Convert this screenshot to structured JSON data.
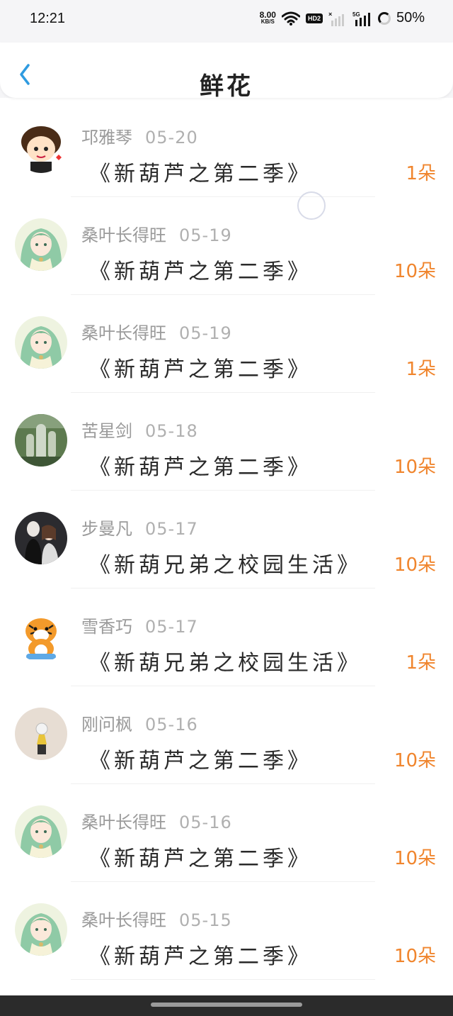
{
  "status_bar": {
    "time": "12:21",
    "net_speed_value": "8.00",
    "net_speed_unit": "KB/S",
    "hd_label": "HD2",
    "network_label": "5G",
    "battery": "50%"
  },
  "header": {
    "title": "鲜花"
  },
  "records": [
    {
      "name": "邛雅琴",
      "date": "05-20",
      "work": "《新葫芦之第二季》",
      "amount": "1朵",
      "avatar": "cartoon-boy"
    },
    {
      "name": "桑叶长得旺",
      "date": "05-19",
      "work": "《新葫芦之第二季》",
      "amount": "10朵",
      "avatar": "anime-girl"
    },
    {
      "name": "桑叶长得旺",
      "date": "05-19",
      "work": "《新葫芦之第二季》",
      "amount": "1朵",
      "avatar": "anime-girl"
    },
    {
      "name": "苦星剑",
      "date": "05-18",
      "work": "《新葫芦之第二季》",
      "amount": "10朵",
      "avatar": "cactus"
    },
    {
      "name": "步曼凡",
      "date": "05-17",
      "work": "《新葫兄弟之校园生活》",
      "amount": "10朵",
      "avatar": "dark-couple"
    },
    {
      "name": "雪香巧",
      "date": "05-17",
      "work": "《新葫兄弟之校园生活》",
      "amount": "1朵",
      "avatar": "tiger"
    },
    {
      "name": "刚问枫",
      "date": "05-16",
      "work": "《新葫芦之第二季》",
      "amount": "10朵",
      "avatar": "small-figure"
    },
    {
      "name": "桑叶长得旺",
      "date": "05-16",
      "work": "《新葫芦之第二季》",
      "amount": "10朵",
      "avatar": "anime-girl"
    },
    {
      "name": "桑叶长得旺",
      "date": "05-15",
      "work": "《新葫芦之第二季》",
      "amount": "10朵",
      "avatar": "anime-girl"
    }
  ],
  "colors": {
    "accent_amount": "#f0852d",
    "back_arrow": "#2f9be0",
    "name_gray": "#9a9a9a"
  }
}
